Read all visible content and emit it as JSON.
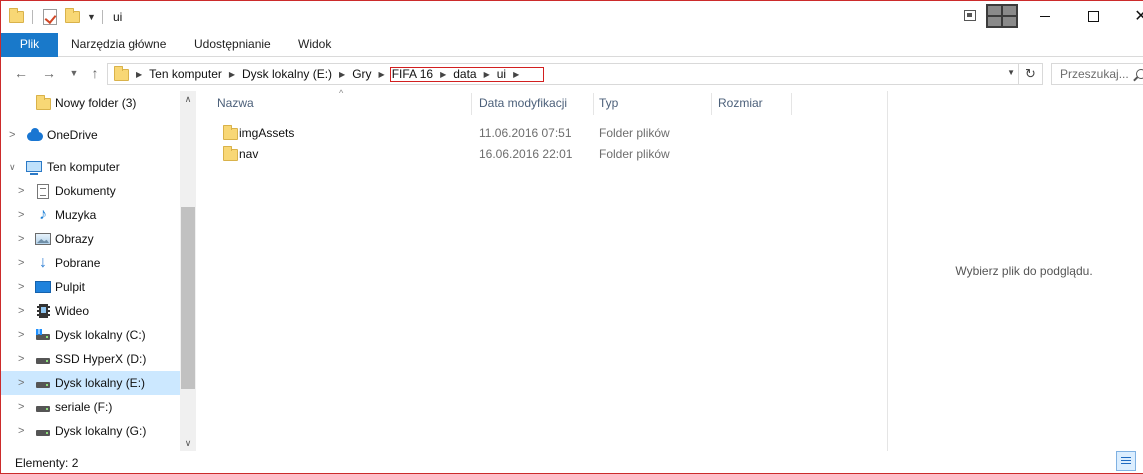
{
  "title_bar": {
    "path_title": "ui",
    "quick_access": [
      "folder-icon",
      "properties-icon",
      "new-folder-icon",
      "customize-dropdown-icon"
    ]
  },
  "ribbon": {
    "tabs": [
      "Plik",
      "Narzędzia główne",
      "Udostępnianie",
      "Widok"
    ],
    "file_tab_color": "#1979CA"
  },
  "address": {
    "breadcrumbs": [
      "Ten komputer",
      "Dysk lokalny (E:)",
      "Gry",
      "FIFA 16",
      "data",
      "ui"
    ],
    "highlight_color": "#D21F1F",
    "search_placeholder": "Przeszukaj..."
  },
  "sidebar": {
    "items": [
      {
        "label": "Nowy folder (3)",
        "icon": "folder-icon",
        "expandable": false,
        "selected": false
      },
      {
        "label": "OneDrive",
        "icon": "onedrive-icon",
        "expandable": true,
        "expanded": false,
        "selected": false
      },
      {
        "label": "Ten komputer",
        "icon": "computer-icon",
        "expandable": true,
        "expanded": true,
        "selected": false
      },
      {
        "label": "Dokumenty",
        "icon": "documents-icon",
        "expandable": true,
        "selected": false
      },
      {
        "label": "Muzyka",
        "icon": "music-icon",
        "expandable": true,
        "selected": false
      },
      {
        "label": "Obrazy",
        "icon": "pictures-icon",
        "expandable": true,
        "selected": false
      },
      {
        "label": "Pobrane",
        "icon": "downloads-icon",
        "expandable": true,
        "selected": false
      },
      {
        "label": "Pulpit",
        "icon": "desktop-icon",
        "expandable": true,
        "selected": false
      },
      {
        "label": "Wideo",
        "icon": "video-icon",
        "expandable": true,
        "selected": false
      },
      {
        "label": "Dysk lokalny (C:)",
        "icon": "system-drive-icon",
        "expandable": true,
        "selected": false
      },
      {
        "label": "SSD HyperX (D:)",
        "icon": "drive-icon",
        "expandable": true,
        "selected": false
      },
      {
        "label": "Dysk lokalny (E:)",
        "icon": "drive-icon",
        "expandable": true,
        "selected": true
      },
      {
        "label": "seriale (F:)",
        "icon": "drive-icon",
        "expandable": true,
        "selected": false
      },
      {
        "label": "Dysk lokalny (G:)",
        "icon": "drive-icon",
        "expandable": true,
        "selected": false
      }
    ],
    "selected_color": "#CCE8FF"
  },
  "file_list": {
    "columns": [
      "Nazwa",
      "Data modyfikacji",
      "Typ",
      "Rozmiar"
    ],
    "rows": [
      {
        "name": "imgAssets",
        "date": "11.06.2016 07:51",
        "type": "Folder plików",
        "size": ""
      },
      {
        "name": "nav",
        "date": "16.06.2016 22:01",
        "type": "Folder plików",
        "size": ""
      }
    ],
    "folder_color": "#F8D775"
  },
  "preview": {
    "message": "Wybierz plik do podglądu."
  },
  "status_bar": {
    "item_count": "Elementy: 2"
  }
}
